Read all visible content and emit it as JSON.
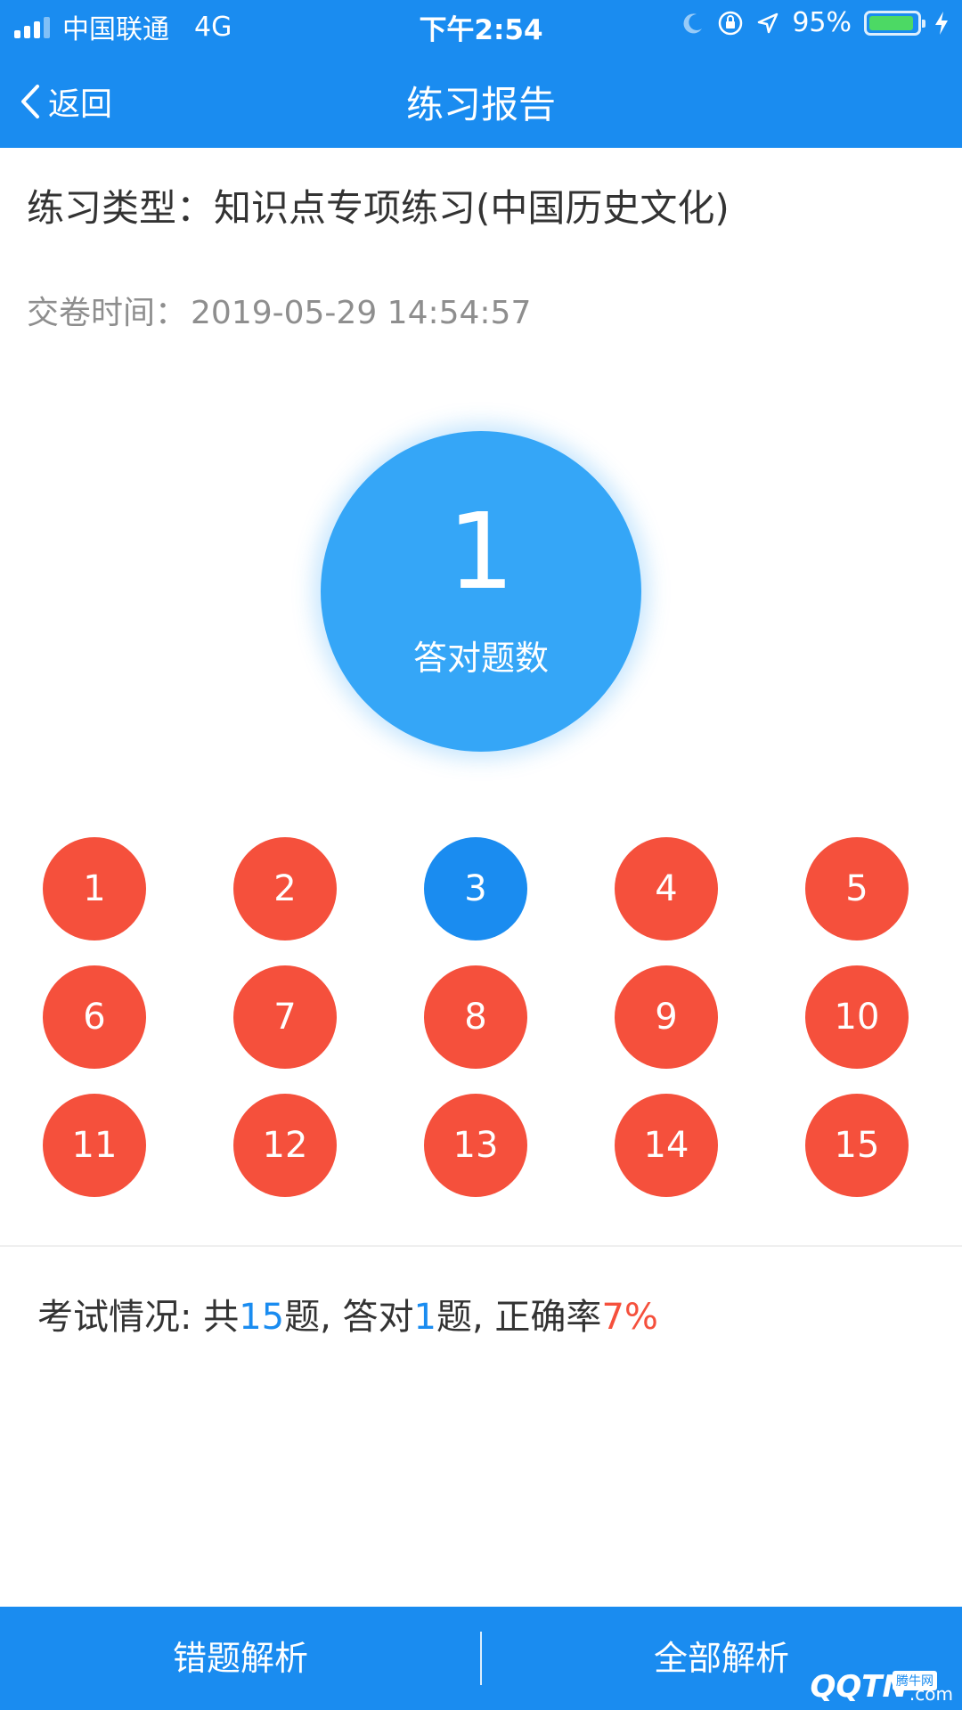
{
  "status_bar": {
    "carrier": "中国联通",
    "network": "4G",
    "time": "下午2:54",
    "battery_percent": "95%",
    "battery_level": 0.95,
    "icons": [
      "signal-icon",
      "moon-icon",
      "orientation-lock-icon",
      "location-icon",
      "battery-icon",
      "charging-icon"
    ]
  },
  "nav": {
    "back_label": "返回",
    "title": "练习报告"
  },
  "report": {
    "type_label": "练习类型：",
    "type_value": "知识点专项练习(中国历史文化)",
    "time_label": "交卷时间：",
    "time_value": "2019-05-29 14:54:57"
  },
  "score": {
    "value": "1",
    "label": "答对题数",
    "color": "#35a6f7"
  },
  "questions": [
    {
      "num": "1",
      "status": "wrong"
    },
    {
      "num": "2",
      "status": "wrong"
    },
    {
      "num": "3",
      "status": "correct"
    },
    {
      "num": "4",
      "status": "wrong"
    },
    {
      "num": "5",
      "status": "wrong"
    },
    {
      "num": "6",
      "status": "wrong"
    },
    {
      "num": "7",
      "status": "wrong"
    },
    {
      "num": "8",
      "status": "wrong"
    },
    {
      "num": "9",
      "status": "wrong"
    },
    {
      "num": "10",
      "status": "wrong"
    },
    {
      "num": "11",
      "status": "wrong"
    },
    {
      "num": "12",
      "status": "wrong"
    },
    {
      "num": "13",
      "status": "wrong"
    },
    {
      "num": "14",
      "status": "wrong"
    },
    {
      "num": "15",
      "status": "wrong"
    }
  ],
  "colors": {
    "brand": "#1a8cf0",
    "correct": "#1a8cf0",
    "wrong": "#f5503c",
    "highlight_blue": "#1a8cf0",
    "highlight_red": "#f5503c"
  },
  "summary": {
    "prefix": "考试情况: 共",
    "total": "15",
    "mid1": "题, 答对",
    "correct": "1",
    "mid2": "题, 正确率",
    "rate": "7%"
  },
  "bottom": {
    "wrong_analysis_label": "错题解析",
    "all_analysis_label": "全部解析"
  },
  "watermark": {
    "text": "QQTN",
    "suffix": ".com",
    "sub": "腾牛网"
  }
}
